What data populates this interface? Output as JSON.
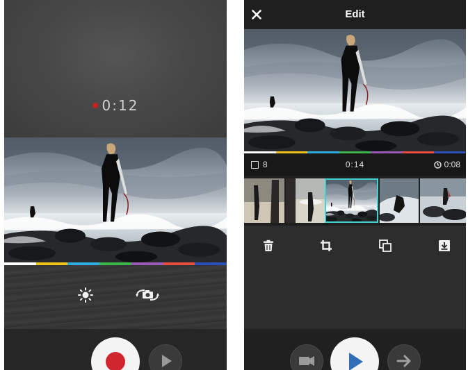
{
  "recorder": {
    "timer": "0:12",
    "icons": [
      "brightness-icon",
      "flip-camera-icon",
      "record-button",
      "play-icon"
    ]
  },
  "editor": {
    "title": "Edit",
    "clip_count": "8",
    "total_duration": "0:14",
    "clip_duration": "0:08",
    "tools": [
      "delete-icon",
      "crop-icon",
      "duplicate-icon",
      "download-icon"
    ],
    "bottom_icons": [
      "video-camera-icon",
      "play-icon",
      "arrow-right-icon"
    ]
  },
  "colors": {
    "accent_selected": "#3fd2d0",
    "record_red": "#d02630",
    "play_blue": "#2f6fb8",
    "color_bar": [
      "#ffffff",
      "#f0c419",
      "#2eaee0",
      "#3ab54a",
      "#9b59b6",
      "#e74c3c",
      "#2b4fb6"
    ]
  }
}
